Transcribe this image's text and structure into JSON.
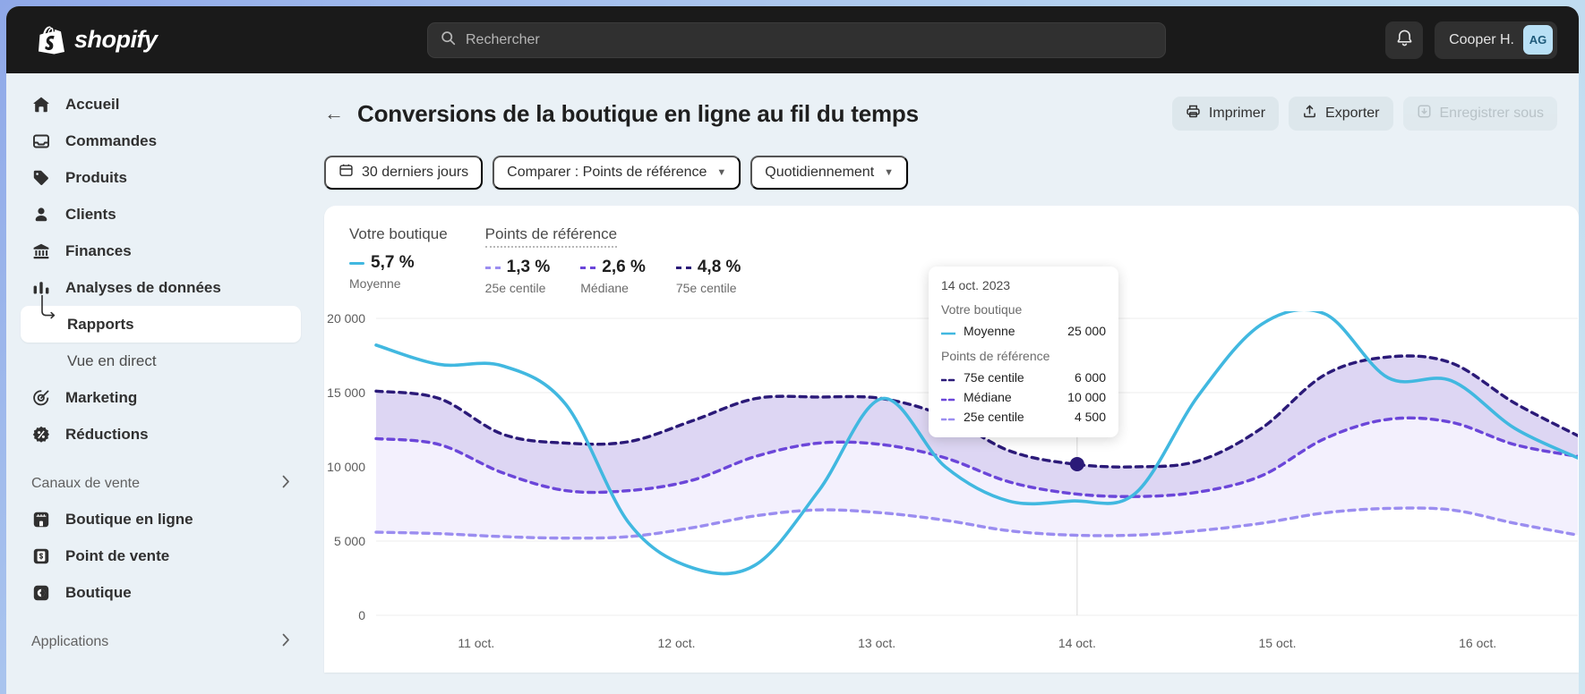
{
  "topbar": {
    "brand": "shopify",
    "search_placeholder": "Rechercher",
    "notifications_icon": "bell-icon",
    "user_name": "Cooper H.",
    "avatar_initials": "AG"
  },
  "sidebar": {
    "items": [
      {
        "label": "Accueil",
        "icon": "home-icon"
      },
      {
        "label": "Commandes",
        "icon": "orders-inbox-icon"
      },
      {
        "label": "Produits",
        "icon": "tag-icon"
      },
      {
        "label": "Clients",
        "icon": "person-icon"
      },
      {
        "label": "Finances",
        "icon": "bank-icon"
      },
      {
        "label": "Analyses de données",
        "icon": "bar-chart-icon"
      },
      {
        "label": "Rapports",
        "icon": "branch-arrow-icon"
      },
      {
        "label": "Vue en direct",
        "icon": "none"
      },
      {
        "label": "Marketing",
        "icon": "target-cursor-icon"
      },
      {
        "label": "Réductions",
        "icon": "discount-percent-icon"
      }
    ],
    "section_sales": "Canaux de vente",
    "sales_items": [
      {
        "label": "Boutique en ligne",
        "icon": "storefront-icon"
      },
      {
        "label": "Point de vente",
        "icon": "pos-receipt-icon"
      },
      {
        "label": "Boutique",
        "icon": "shop-app-icon"
      }
    ],
    "section_apps": "Applications"
  },
  "header": {
    "back_icon": "arrow-left-icon",
    "title": "Conversions de la boutique en ligne au fil du temps",
    "actions": [
      {
        "label": "Imprimer",
        "icon": "printer-icon",
        "disabled": false
      },
      {
        "label": "Exporter",
        "icon": "upload-icon",
        "disabled": false
      },
      {
        "label": "Enregistrer sous",
        "icon": "save-icon",
        "disabled": true
      }
    ]
  },
  "filters": [
    {
      "label": "30 derniers jours",
      "icon": "calendar-icon",
      "has_chevron": false
    },
    {
      "label": "Comparer : Points de référence",
      "icon": "none",
      "has_chevron": true
    },
    {
      "label": "Quotidiennement",
      "icon": "none",
      "has_chevron": true
    }
  ],
  "legend": {
    "group_store": "Votre boutique",
    "group_benchmark": "Points de référence",
    "store_items": [
      {
        "value": "5,7 %",
        "label": "Moyenne",
        "style": "solid",
        "color": "#41b8e0"
      }
    ],
    "benchmark_items": [
      {
        "value": "1,3 %",
        "label": "25e centile",
        "style": "dashed",
        "color": "#9b8df0"
      },
      {
        "value": "2,6 %",
        "label": "Médiane",
        "style": "dashed",
        "color": "#6b46d9"
      },
      {
        "value": "4,8 %",
        "label": "75e centile",
        "style": "dashed",
        "color": "#2b1a78"
      }
    ]
  },
  "tooltip": {
    "date": "14 oct. 2023",
    "group_store": "Votre boutique",
    "store_rows": [
      {
        "name": "Moyenne",
        "value": "25 000",
        "style": "solid",
        "color": "#41b8e0"
      }
    ],
    "group_benchmark": "Points de référence",
    "benchmark_rows": [
      {
        "name": "75e centile",
        "value": "6 000",
        "style": "dashed",
        "color": "#2b1a78"
      },
      {
        "name": "Médiane",
        "value": "10 000",
        "style": "dashed",
        "color": "#6b46d9"
      },
      {
        "name": "25e centile",
        "value": "4 500",
        "style": "dashed",
        "color": "#9b8df0"
      }
    ]
  },
  "chart_data": {
    "type": "line",
    "title": "Conversions de la boutique en ligne au fil du temps",
    "xlabel": "",
    "ylabel": "",
    "ylim": [
      0,
      20000
    ],
    "yticks": [
      0,
      5000,
      10000,
      15000,
      20000
    ],
    "ytick_labels": [
      "0",
      "5 000",
      "10 000",
      "15 000",
      "20 000"
    ],
    "x": [
      "11 oct.",
      "12 oct.",
      "13 oct.",
      "14 oct.",
      "15 oct.",
      "16 oct."
    ],
    "xtick_labels": [
      "11 oct.",
      "12 oct.",
      "13 oct.",
      "14 oct.",
      "15 oct.",
      "16 oct."
    ],
    "grid": true,
    "legend_position": "top-left",
    "highlight_point": {
      "x": "14 oct.",
      "series": "75e centile",
      "value": 10000
    },
    "series": [
      {
        "name": "Moyenne",
        "group": "Votre boutique",
        "style": "solid",
        "color": "#41b8e0",
        "values": [
          18200,
          16900,
          16800,
          14200,
          6200,
          3200,
          3400,
          8400,
          14600,
          10000,
          7700,
          7700,
          8200,
          14800,
          19600,
          20300,
          16000,
          15800,
          12600,
          10600
        ]
      },
      {
        "name": "75e centile",
        "group": "Points de référence",
        "style": "dashed",
        "color": "#2b1a78",
        "values": [
          15100,
          14600,
          12200,
          11600,
          11700,
          13100,
          14600,
          14700,
          14600,
          13400,
          11100,
          10200,
          10000,
          10400,
          12600,
          16200,
          17400,
          17000,
          14300,
          12100
        ]
      },
      {
        "name": "Médiane",
        "group": "Points de référence",
        "style": "dashed",
        "color": "#6b46d9",
        "values": [
          11900,
          11500,
          9600,
          8400,
          8400,
          9100,
          10700,
          11600,
          11500,
          10600,
          9000,
          8200,
          8000,
          8300,
          9400,
          11900,
          13200,
          13000,
          11500,
          10700
        ]
      },
      {
        "name": "25e centile",
        "group": "Points de référence",
        "style": "dashed",
        "color": "#9b8df0",
        "values": [
          5600,
          5500,
          5300,
          5200,
          5300,
          5900,
          6700,
          7100,
          6900,
          6400,
          5700,
          5400,
          5400,
          5700,
          6200,
          6900,
          7200,
          7100,
          6200,
          5400
        ]
      }
    ]
  }
}
